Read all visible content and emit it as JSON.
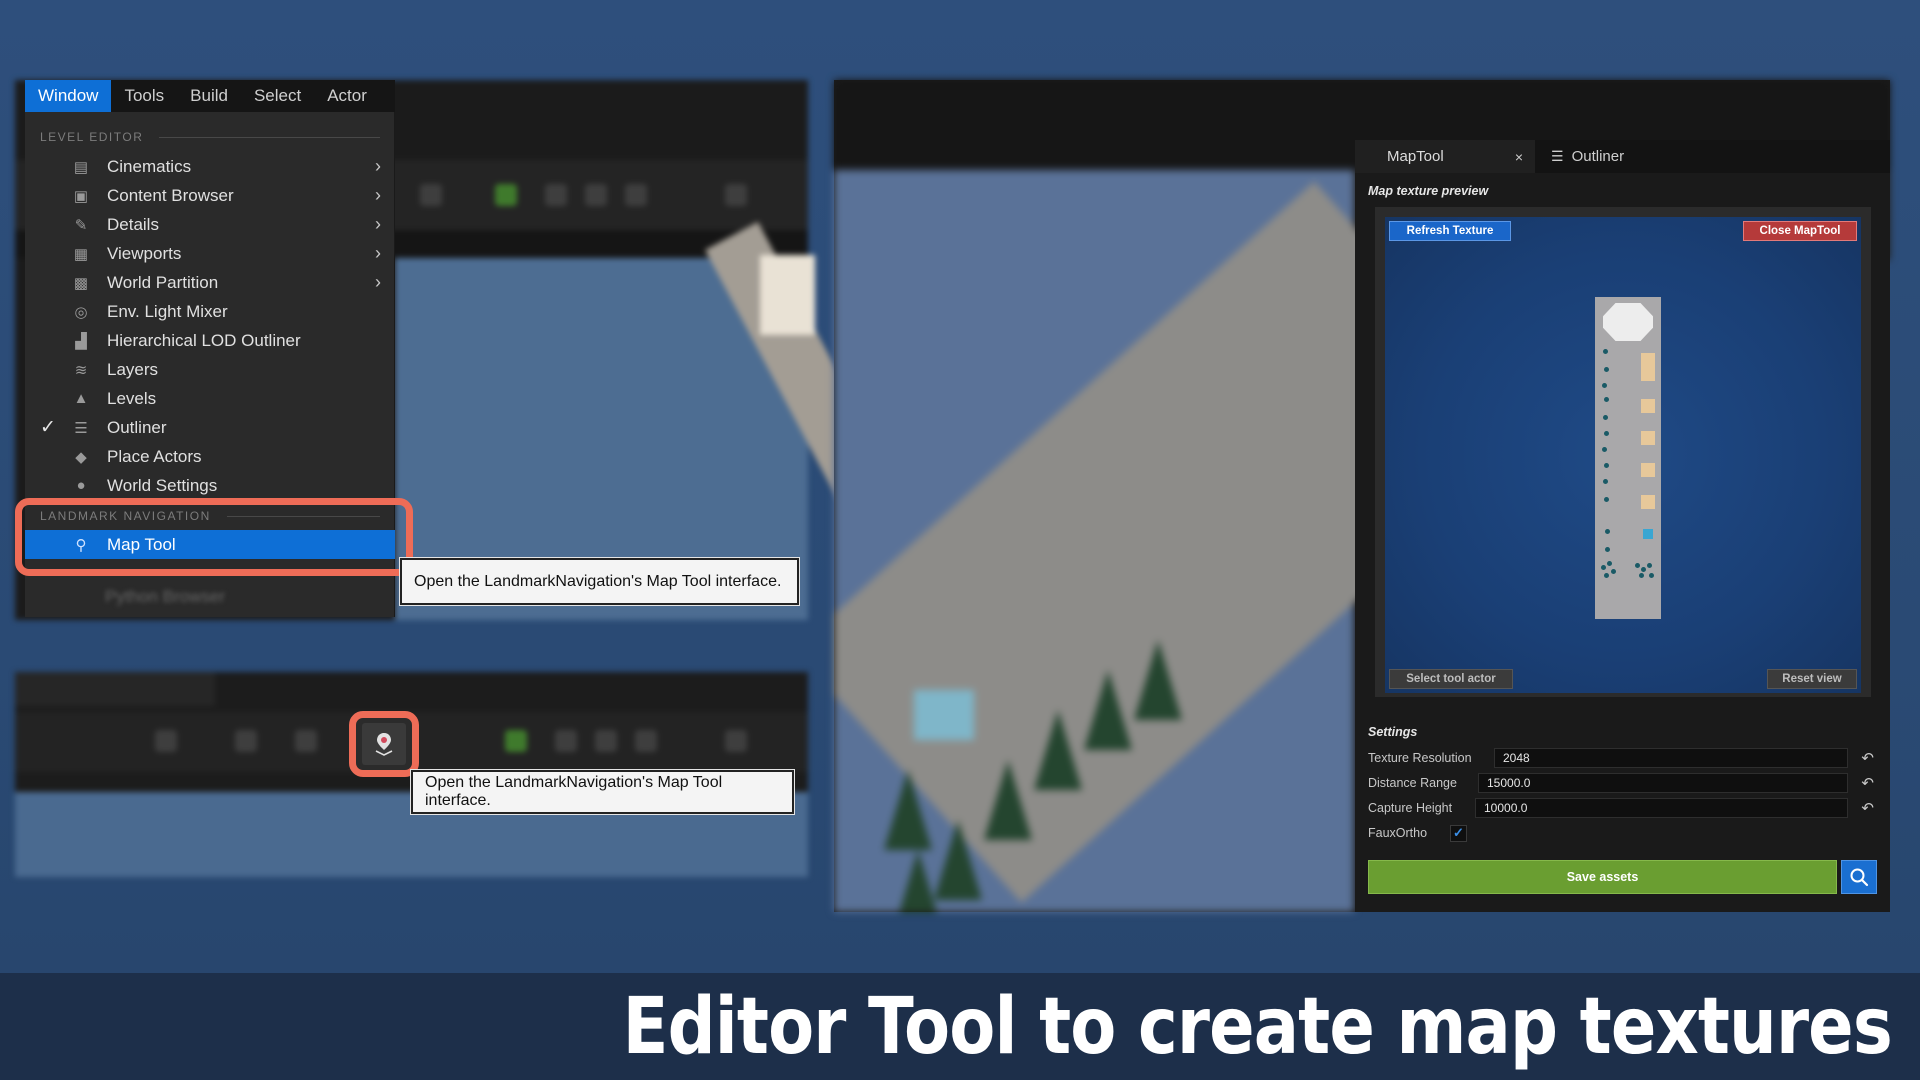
{
  "menubar": {
    "items": [
      "Window",
      "Tools",
      "Build",
      "Select",
      "Actor"
    ],
    "active": "Window"
  },
  "menu": {
    "section_level_editor": "LEVEL EDITOR",
    "items": [
      {
        "label": "Cinematics",
        "icon": "clapperboard-icon",
        "submenu": true,
        "checked": false
      },
      {
        "label": "Content Browser",
        "icon": "folder-browser-icon",
        "submenu": true,
        "checked": false
      },
      {
        "label": "Details",
        "icon": "pencil-icon",
        "submenu": true,
        "checked": false
      },
      {
        "label": "Viewports",
        "icon": "viewports-icon",
        "submenu": true,
        "checked": false
      },
      {
        "label": "World Partition",
        "icon": "world-partition-icon",
        "submenu": true,
        "checked": false
      },
      {
        "label": "Env. Light Mixer",
        "icon": "light-mixer-icon",
        "submenu": false,
        "checked": false
      },
      {
        "label": "Hierarchical LOD Outliner",
        "icon": "lod-icon",
        "submenu": false,
        "checked": false
      },
      {
        "label": "Layers",
        "icon": "layers-icon",
        "submenu": false,
        "checked": false
      },
      {
        "label": "Levels",
        "icon": "levels-icon",
        "submenu": false,
        "checked": false
      },
      {
        "label": "Outliner",
        "icon": "outliner-icon",
        "submenu": false,
        "checked": true
      },
      {
        "label": "Place Actors",
        "icon": "place-actors-icon",
        "submenu": false,
        "checked": false
      },
      {
        "label": "World Settings",
        "icon": "globe-icon",
        "submenu": false,
        "checked": false
      }
    ],
    "section_landmark": "LANDMARK NAVIGATION",
    "map_tool_label": "Map Tool",
    "ghost_item": "Python Browser"
  },
  "tooltips": {
    "menu": "Open the LandmarkNavigation's Map Tool interface.",
    "toolbar": "Open the LandmarkNavigation's Map Tool interface."
  },
  "maptool": {
    "tab_label": "MapTool",
    "tab_close": "×",
    "outliner_tab": "Outliner",
    "preview_label": "Map texture preview",
    "refresh_button": "Refresh Texture",
    "close_button": "Close MapTool",
    "select_button": "Select tool actor",
    "reset_view_button": "Reset view",
    "settings_label": "Settings",
    "settings": {
      "texture_resolution_label": "Texture Resolution",
      "texture_resolution": "2048",
      "distance_range_label": "Distance Range",
      "distance_range": "15000.0",
      "capture_height_label": "Capture Height",
      "capture_height": "10000.0",
      "faux_ortho_label": "FauxOrtho",
      "faux_ortho": true
    },
    "save_button": "Save assets"
  },
  "caption": "Editor Tool to create map textures",
  "colors": {
    "accent_blue": "#0e6fd6",
    "highlight": "#ee6c57",
    "save_green": "#6a9e31",
    "close_red": "#b53a3a"
  }
}
